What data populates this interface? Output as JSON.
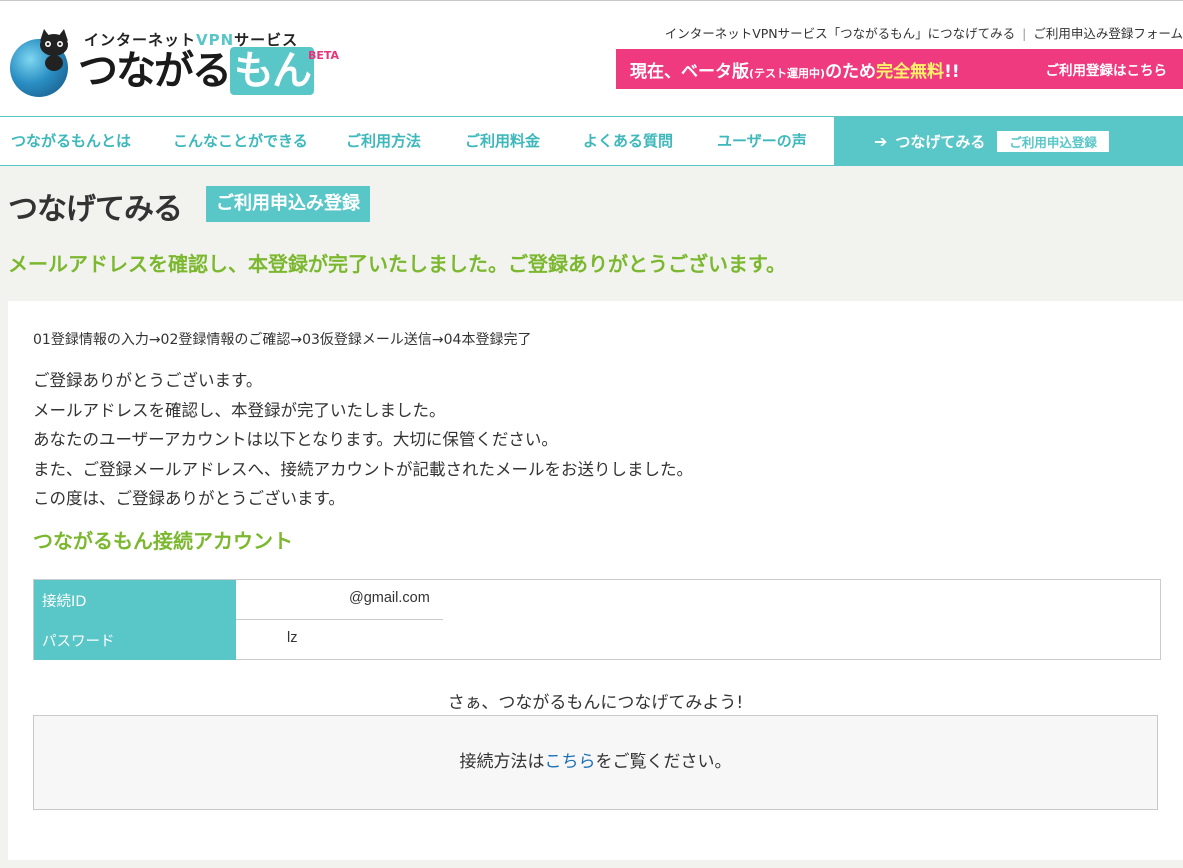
{
  "header": {
    "tagline_pre": "インターネット",
    "tagline_vpn": "VPN",
    "tagline_post": "サービス",
    "brand_pre": "つながる",
    "brand_mon": "もん",
    "beta": "BETA",
    "breadcrumb_site": "インターネットVPNサービス「つながるもん」につなげてみる",
    "breadcrumb_sep": "|",
    "breadcrumb_page": "ご利用申込み登録フォーム",
    "promo_pre": "現在、ベータ版",
    "promo_small": "(テスト運用中)",
    "promo_mid": "のため",
    "promo_free": "完全無料",
    "promo_post": "!!",
    "promo_cta": "ご利用登録はこちら"
  },
  "nav": {
    "items": [
      "つながるもんとは",
      "こんなことができる",
      "ご利用方法",
      "ご利用料金",
      "よくある質問",
      "ユーザーの声"
    ],
    "cta_label": "つなげてみる",
    "cta_tag": "ご利用申込登録"
  },
  "page": {
    "title": "つなげてみる",
    "title_tag": "ご利用申込み登録",
    "subtitle": "メールアドレスを確認し、本登録が完了いたしました。ご登録ありがとうございます。"
  },
  "content": {
    "steps": "01登録情報の入力→02登録情報のご確認→03仮登録メール送信→04本登録完了",
    "messages": [
      "ご登録ありがとうございます。",
      "メールアドレスを確認し、本登録が完了いたしました。",
      "あなたのユーザーアカウントは以下となります。大切に保管ください。",
      "また、ご登録メールアドレスへ、接続アカウントが記載されたメールをお送りしました。",
      "この度は、ご登録ありがとうございます。"
    ],
    "account_title": "つながるもん接続アカウント",
    "account": {
      "id_label": "接続ID",
      "id_value": "@gmail.com",
      "password_label": "パスワード",
      "password_value": "lz"
    },
    "lets_connect": "さぁ、つながるもんにつなげてみよう!",
    "guide_pre": "接続方法は",
    "guide_link": "こちら",
    "guide_post": "をご覧ください。"
  },
  "colors": {
    "teal": "#59c6c8",
    "green": "#7cb82f",
    "pink": "#ef3a80",
    "yellow": "#fff36a",
    "link": "#1a6fb5"
  }
}
